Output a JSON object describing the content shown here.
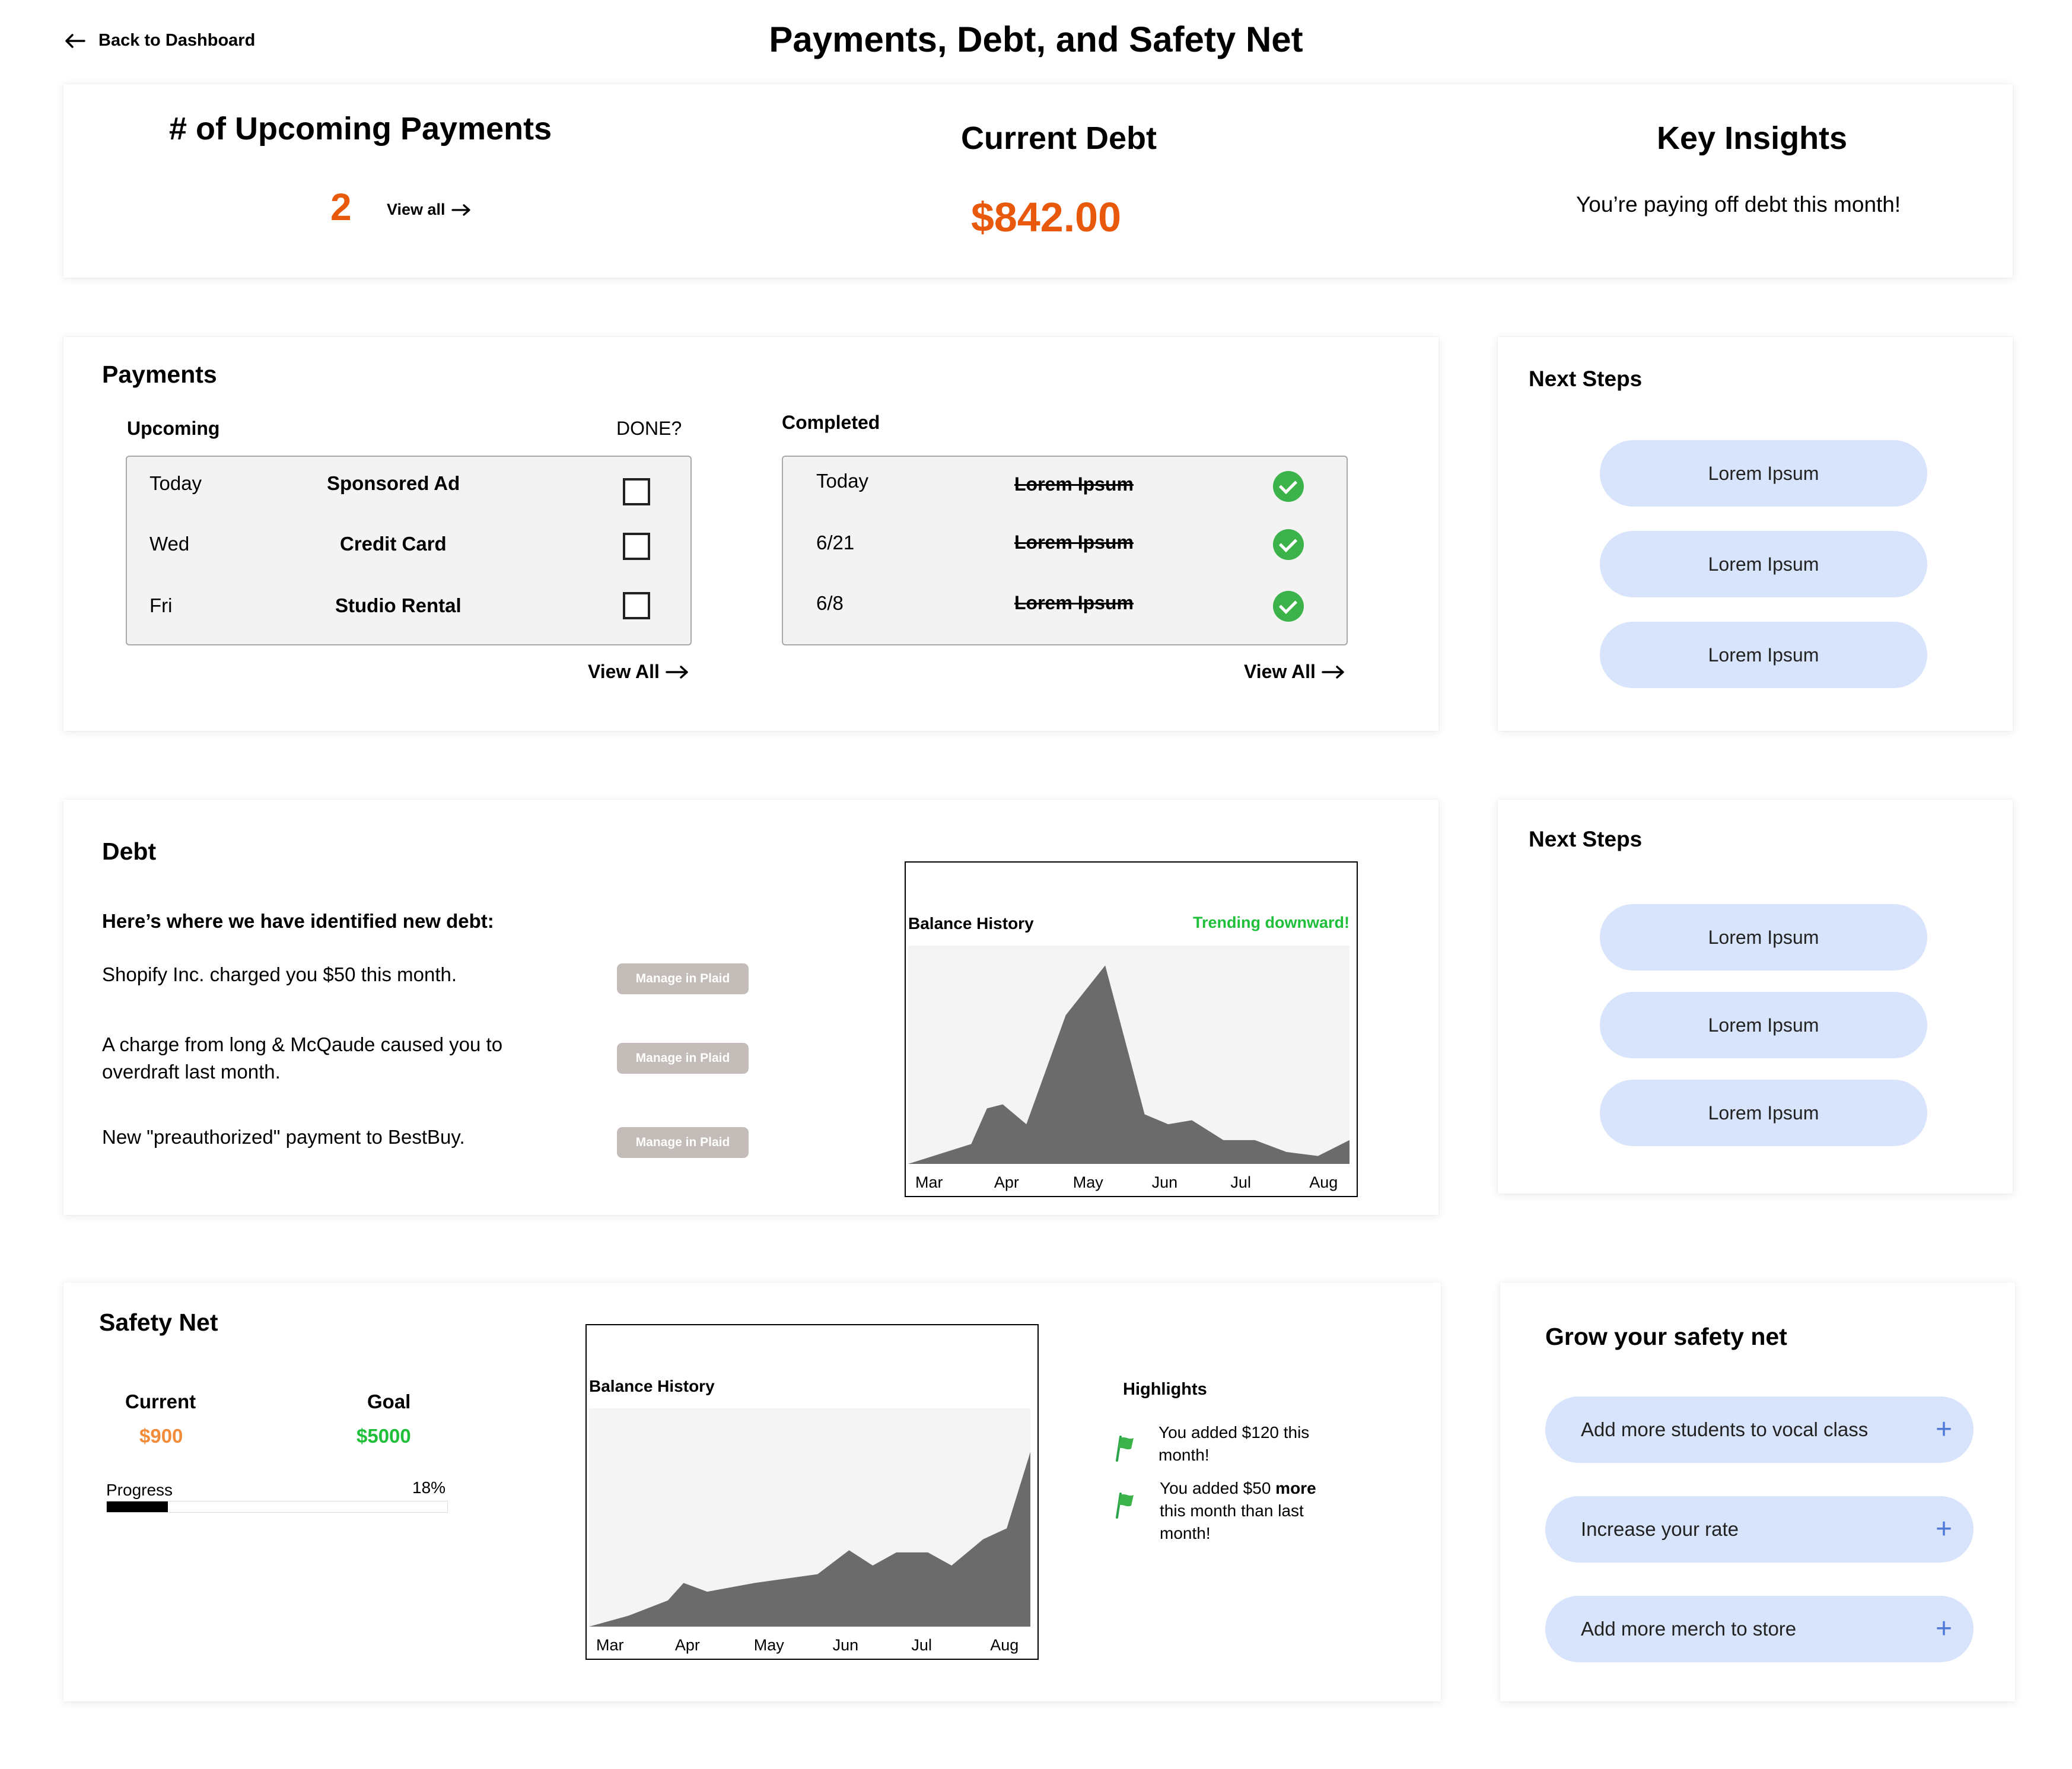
{
  "nav": {
    "back_label": "Back to Dashboard",
    "page_title": "Payments, Debt, and Safety Net"
  },
  "summary": {
    "upcoming": {
      "title": "# of Upcoming Payments",
      "count": "2",
      "link": "View all"
    },
    "debt": {
      "title": "Current Debt",
      "amount": "$842.00"
    },
    "insights": {
      "title": "Key Insights",
      "text": "You’re paying off debt this month!"
    }
  },
  "payments": {
    "title": "Payments",
    "upcoming_label": "Upcoming",
    "done_label": "DONE?",
    "completed_label": "Completed",
    "upcoming": [
      {
        "when": "Today",
        "name": "Sponsored Ad"
      },
      {
        "when": "Wed",
        "name": "Credit Card"
      },
      {
        "when": "Fri",
        "name": "Studio Rental"
      }
    ],
    "completed": [
      {
        "when": "Today",
        "name": "Lorem Ipsum"
      },
      {
        "when": "6/21",
        "name": "Lorem Ipsum"
      },
      {
        "when": "6/8",
        "name": "Lorem Ipsum"
      }
    ],
    "view_all_label": "View All"
  },
  "next_steps_1": {
    "title": "Next Steps",
    "items": [
      "Lorem Ipsum",
      "Lorem Ipsum",
      "Lorem Ipsum"
    ]
  },
  "next_steps_2": {
    "title": "Next Steps",
    "items": [
      "Lorem Ipsum",
      "Lorem Ipsum",
      "Lorem Ipsum"
    ]
  },
  "debt": {
    "title": "Debt",
    "subtitle": "Here’s where we have identified new debt:",
    "items": [
      "Shopify Inc. charged you $50 this month.",
      "A charge from long & McQaude caused you to overdraft last month.",
      "New \"preauthorized\" payment to BestBuy."
    ],
    "manage_label": "Manage in Plaid"
  },
  "safety": {
    "title": "Safety Net",
    "current_label": "Current",
    "current_value": "$900",
    "goal_label": "Goal",
    "goal_value": "$5000",
    "progress_label": "Progress",
    "progress_text": "18%",
    "progress": 0.18,
    "highlights_title": "Highlights",
    "highlight_1": "You added $120 this month!",
    "highlight_2_pre": "You added $50 ",
    "highlight_2_bold": "more",
    "highlight_2_post": " this month than last month!"
  },
  "grow": {
    "title": "Grow your safety net",
    "items": [
      "Add more students to vocal class",
      "Increase your rate",
      "Add more merch to store"
    ]
  },
  "colors": {
    "accent_orange": "#e8590c",
    "green": "#3cb34a",
    "pill_blue": "#d8e4fb"
  },
  "chart_data": [
    {
      "type": "area",
      "title": "Balance History",
      "annotation": "Trending downward!",
      "categories": [
        "Mar",
        "Apr",
        "May",
        "Jun",
        "Jul",
        "Aug"
      ],
      "x": [
        0,
        0.4,
        0.8,
        1.0,
        1.2,
        1.5,
        2.0,
        2.5,
        3.0,
        3.3,
        3.6,
        4.0,
        4.4,
        4.8,
        5.2,
        5.6
      ],
      "y": [
        0,
        5,
        10,
        28,
        30,
        20,
        75,
        100,
        25,
        20,
        22,
        12,
        12,
        6,
        4,
        12
      ],
      "ylim": [
        0,
        110
      ]
    },
    {
      "type": "area",
      "title": "Balance History",
      "categories": [
        "Mar",
        "Apr",
        "May",
        "Jun",
        "Jul",
        "Aug"
      ],
      "x": [
        0,
        0.5,
        1.0,
        1.2,
        1.5,
        1.8,
        2.1,
        2.5,
        2.9,
        3.3,
        3.6,
        3.9,
        4.3,
        4.6,
        5.0,
        5.3,
        5.6
      ],
      "y": [
        0,
        5,
        12,
        20,
        16,
        18,
        20,
        22,
        24,
        35,
        28,
        34,
        34,
        28,
        40,
        45,
        80
      ],
      "ylim": [
        0,
        100
      ]
    }
  ]
}
